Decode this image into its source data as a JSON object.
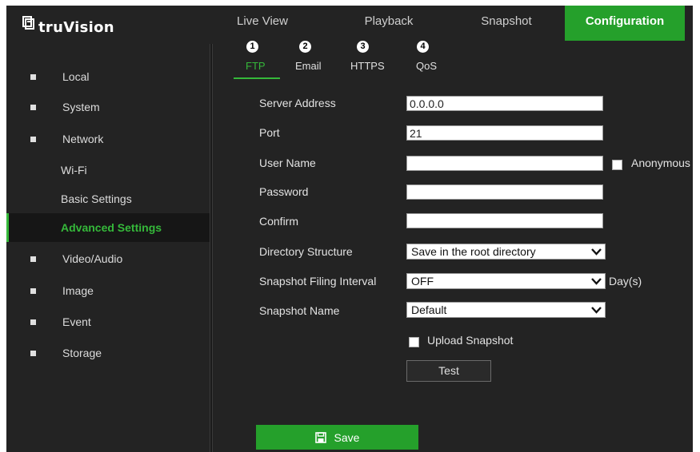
{
  "brand": {
    "name": "truVision"
  },
  "top_tabs": [
    {
      "label": "Live View"
    },
    {
      "label": "Playback"
    },
    {
      "label": "Snapshot"
    },
    {
      "label": "Configuration",
      "active": true
    }
  ],
  "sidebar": {
    "items": [
      {
        "label": "Local"
      },
      {
        "label": "System"
      },
      {
        "label": "Network"
      },
      {
        "label": "Wi-Fi"
      },
      {
        "label": "Basic Settings"
      },
      {
        "label": "Advanced Settings",
        "active": true
      },
      {
        "label": "Video/Audio"
      },
      {
        "label": "Image"
      },
      {
        "label": "Event"
      },
      {
        "label": "Storage"
      }
    ]
  },
  "sub_tabs": [
    {
      "badge": "1",
      "label": "FTP",
      "active": true
    },
    {
      "badge": "2",
      "label": "Email"
    },
    {
      "badge": "3",
      "label": "HTTPS"
    },
    {
      "badge": "4",
      "label": "QoS"
    }
  ],
  "form": {
    "server_address": {
      "label": "Server Address",
      "value": "0.0.0.0"
    },
    "port": {
      "label": "Port",
      "value": "21"
    },
    "user_name": {
      "label": "User Name",
      "value": ""
    },
    "anonymous": {
      "label": "Anonymous",
      "checked": false
    },
    "password": {
      "label": "Password",
      "value": ""
    },
    "confirm": {
      "label": "Confirm",
      "value": ""
    },
    "directory_structure": {
      "label": "Directory Structure",
      "value": "Save in the root directory"
    },
    "snapshot_interval": {
      "label": "Snapshot Filing Interval",
      "value": "OFF",
      "unit": "Day(s)"
    },
    "snapshot_name": {
      "label": "Snapshot Name",
      "value": "Default"
    },
    "upload_snapshot": {
      "label": "Upload Snapshot",
      "checked": false
    },
    "test_label": "Test",
    "save_label": "Save"
  },
  "colors": {
    "accent": "#25a02b",
    "active_text": "#35b83a",
    "background": "#232323"
  }
}
